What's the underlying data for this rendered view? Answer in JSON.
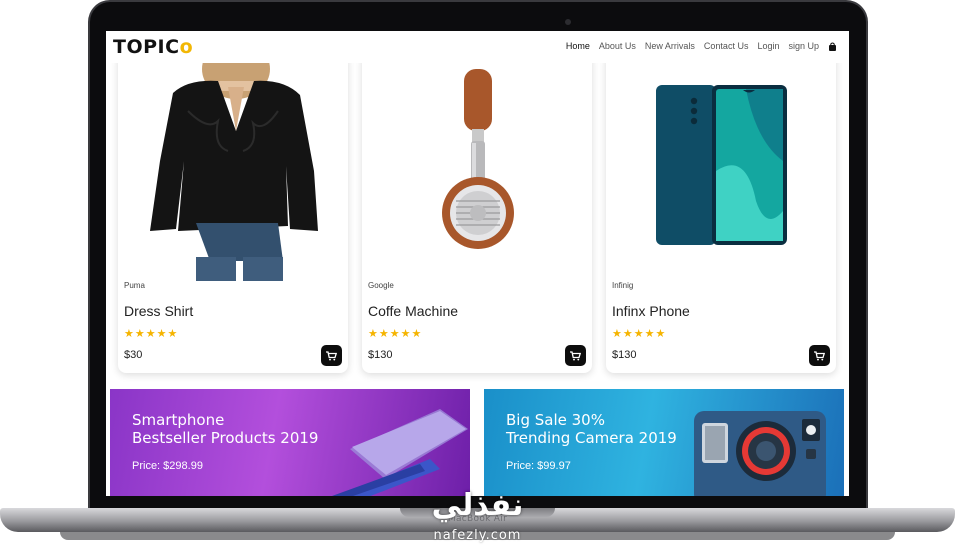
{
  "header": {
    "logo_text": "TOPIC",
    "logo_accent": "o",
    "nav": [
      "Home",
      "About Us",
      "New Arrivals",
      "Contact Us",
      "Login",
      "sign Up"
    ]
  },
  "products": [
    {
      "brand": "Puma",
      "title": "Dress Shirt",
      "rating": 5,
      "stars": "★★★★★",
      "price": "$30",
      "image": "black-blouse"
    },
    {
      "brand": "Google",
      "title": "Coffe Machine",
      "rating": 5,
      "stars": "★★★★★",
      "price": "$130",
      "image": "headphones"
    },
    {
      "brand": "Infinig",
      "title": "Infinx Phone",
      "rating": 5,
      "stars": "★★★★★",
      "price": "$130",
      "image": "smartphone"
    }
  ],
  "banners": [
    {
      "title": "Smartphone\nBestseller Products 2019",
      "price": "Price: $298.99",
      "image": "smartphone-promo"
    },
    {
      "title": "Big Sale 30%\nTrending Camera 2019",
      "price": "Price: $99.97",
      "image": "instant-camera"
    }
  ],
  "device": {
    "model": "MacBook Air"
  },
  "watermark": {
    "arabic": "نفذلي",
    "url": "nafezly.com"
  },
  "colors": {
    "star": "#f5b400",
    "logo_accent": "#f2b705",
    "cart_button": "#0d0d0d"
  }
}
